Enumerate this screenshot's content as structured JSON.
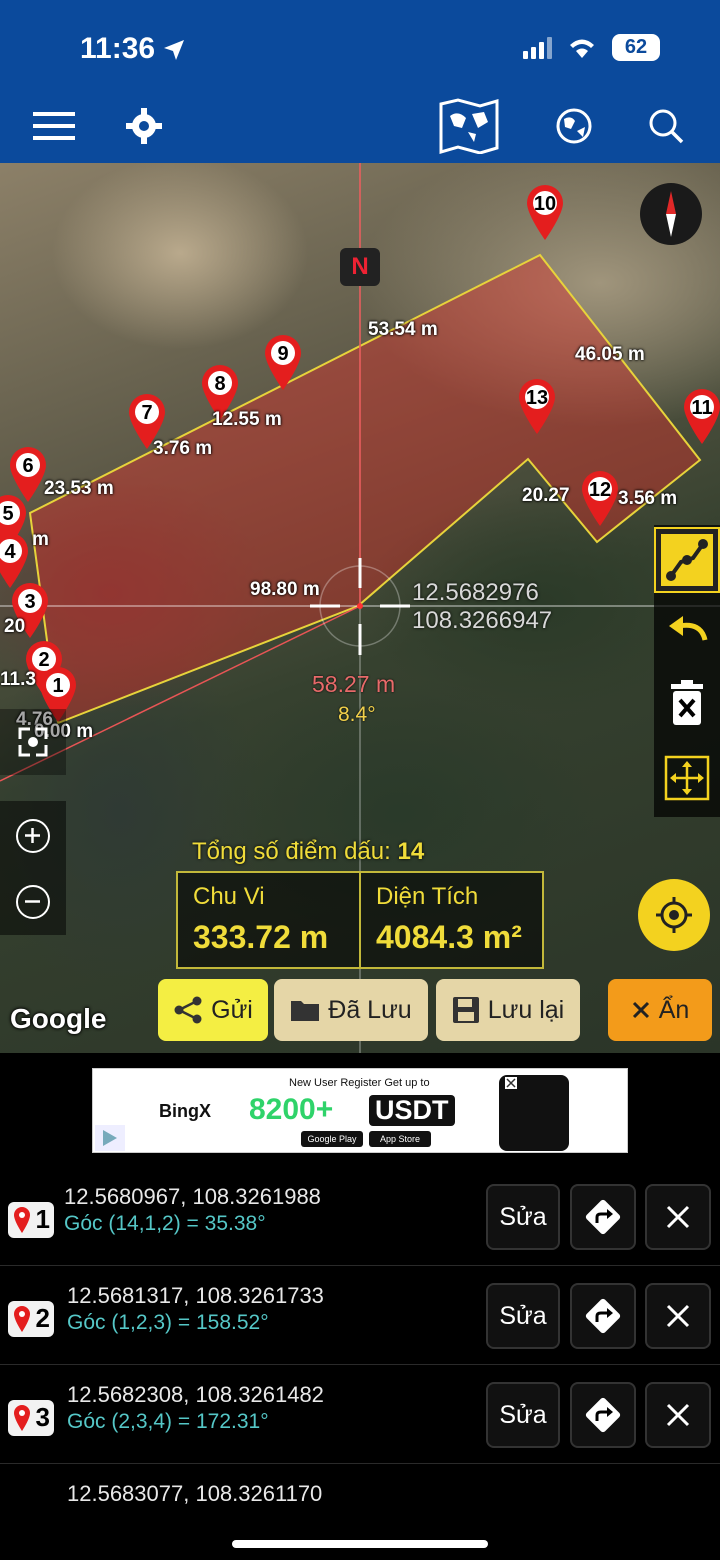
{
  "status": {
    "time": "11:36",
    "battery": "62"
  },
  "toolbar": {
    "menu_icon": "menu-icon",
    "settings_icon": "gear-icon",
    "map_type_icon": "world-map-icon",
    "globe_icon": "globe-icon",
    "search_icon": "search-icon"
  },
  "map": {
    "north_label": "N",
    "segment_labels": [
      "53.54 m",
      "46.05 m",
      "12.55 m",
      "3.76 m",
      "23.53 m",
      "20.27",
      "3.56 m",
      "98.80 m",
      "m",
      "20",
      "11.3",
      "4.76",
      "0.00 m"
    ],
    "pins": [
      "10",
      "9",
      "8",
      "7",
      "6",
      "5",
      "4",
      "3",
      "2",
      "1",
      "13",
      "11",
      "12"
    ],
    "center_coords": [
      "12.5682976",
      "108.3266947"
    ],
    "center_distance": "58.27 m",
    "center_angle": "8.4°",
    "total_points_label": "Tổng số điểm dấu:",
    "total_points_value": "14",
    "perimeter_label": "Chu Vi",
    "perimeter_value": "333.72 m",
    "area_label": "Diện Tích",
    "area_value": "4084.3 m²",
    "attribution": "Google",
    "colors": {
      "polygon_fill": "#e0302a",
      "polygon_stroke": "#e7d33b",
      "accent_yellow": "#f3d21f"
    }
  },
  "actions": {
    "send": "Gửi",
    "saved": "Đã Lưu",
    "save": "Lưu lại",
    "hide": "Ẩn"
  },
  "ad": {
    "headline": "New User Register Get up to",
    "brand": "BingX",
    "amount": "8200+",
    "currency": "USDT",
    "store1": "Google Play",
    "store2": "App Store"
  },
  "points": [
    {
      "num": "1",
      "coords": "12.5680967, 108.3261988",
      "angle": "Góc (14,1,2) = 35.38°"
    },
    {
      "num": "2",
      "coords": "12.5681317, 108.3261733",
      "angle": "Góc (1,2,3) = 158.52°"
    },
    {
      "num": "3",
      "coords": "12.5682308, 108.3261482",
      "angle": "Góc (2,3,4) = 172.31°"
    },
    {
      "num": "4",
      "coords": "12.5683077, 108.3261170",
      "angle": ""
    }
  ],
  "row_actions": {
    "edit": "Sửa"
  }
}
